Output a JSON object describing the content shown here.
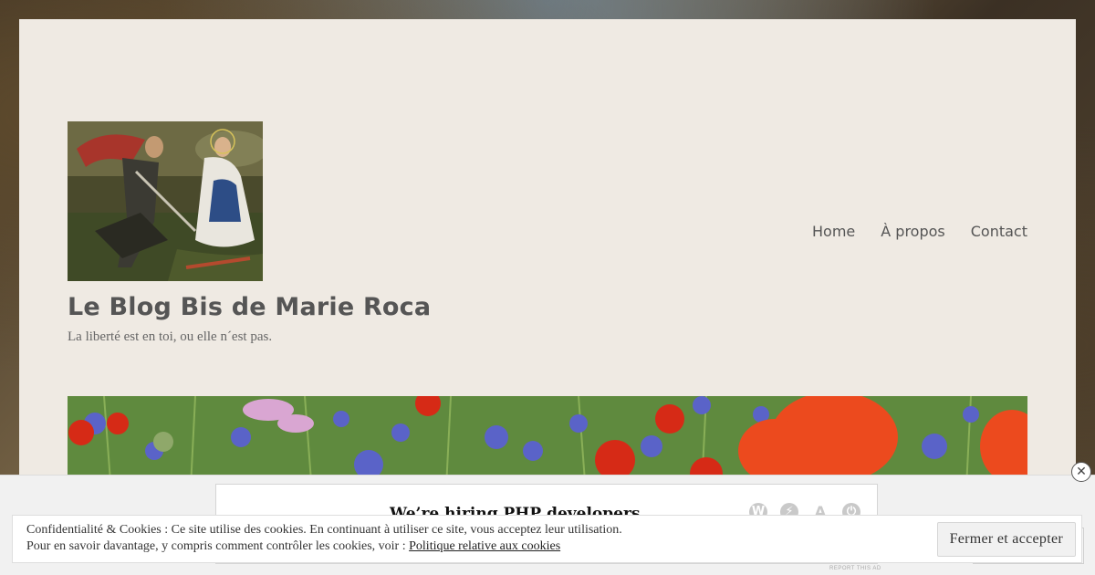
{
  "site": {
    "title": "Le Blog Bis de Marie Roca",
    "tagline": "La liberté est en toi, ou elle n´est pas."
  },
  "nav": {
    "items": [
      {
        "label": "Home"
      },
      {
        "label": "À propos"
      },
      {
        "label": "Contact"
      }
    ]
  },
  "ad": {
    "title": "We’re hiring PHP developers",
    "report_label": "Report this ad",
    "icons": [
      "wordpress-icon",
      "jetpack-icon",
      "font-icon",
      "power-icon"
    ]
  },
  "cookie": {
    "line1": "Confidentialité & Cookies : Ce site utilise des cookies. En continuant à utiliser ce site, vous acceptez leur utilisation.",
    "line2_prefix": "Pour en savoir davantage, y compris comment contrôler les cookies, voir : ",
    "policy_link": "Politique relative aux cookies",
    "accept_label": "Fermer et accepter"
  },
  "colors": {
    "page_bg": "#efeae3",
    "title_text": "#555555"
  }
}
